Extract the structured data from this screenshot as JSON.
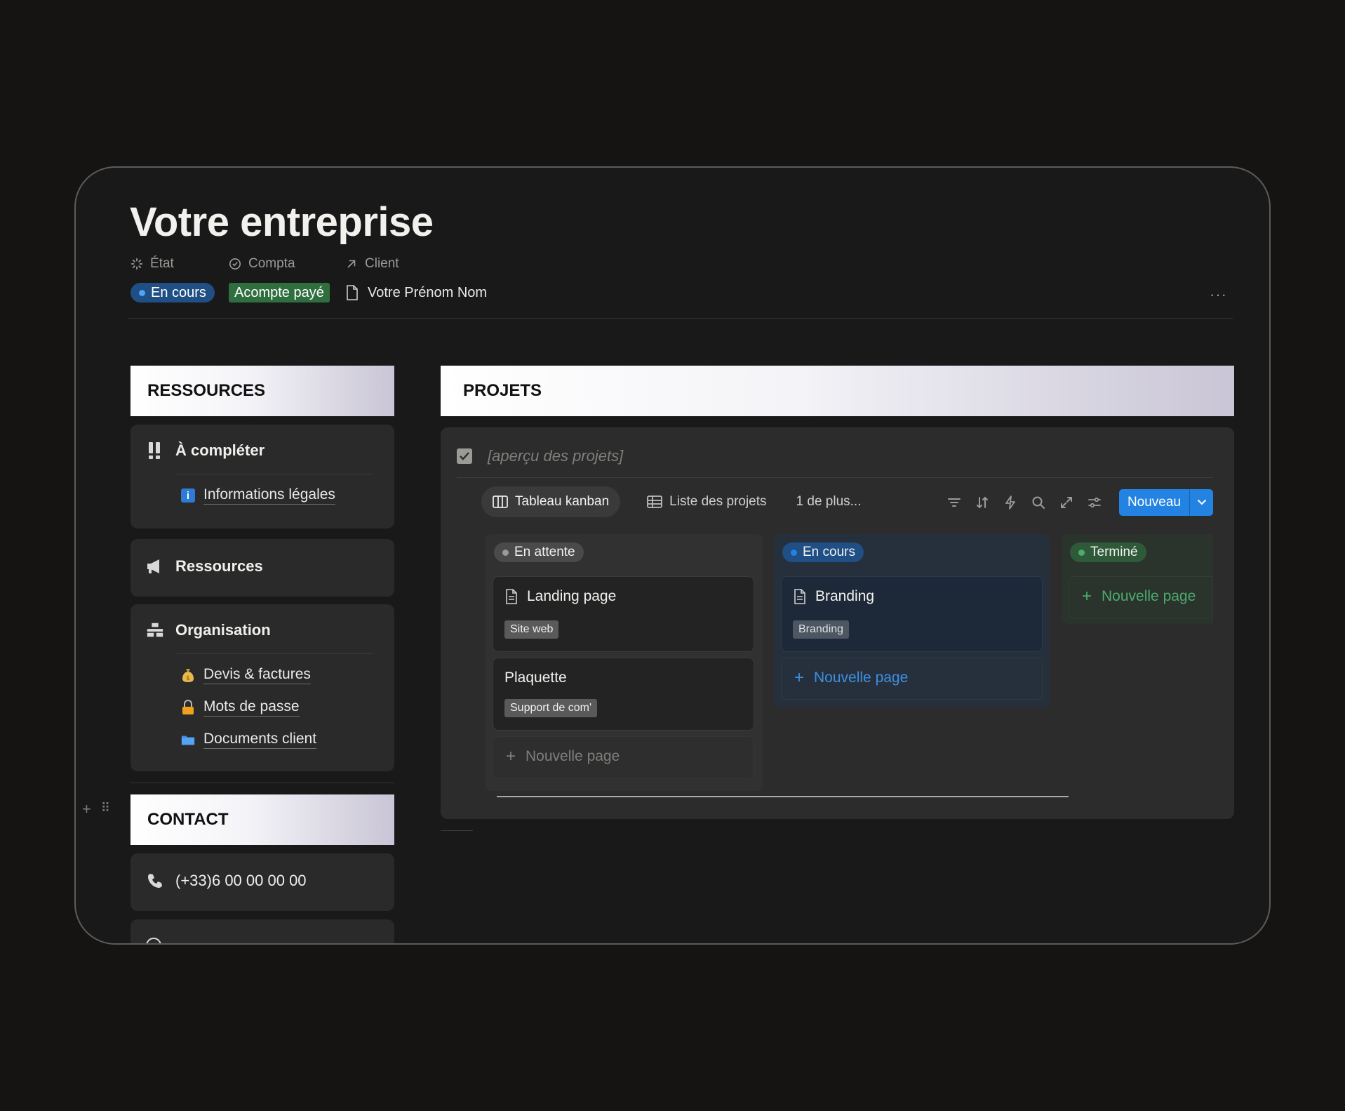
{
  "page": {
    "title": "Votre entreprise",
    "more_label": "···"
  },
  "properties": {
    "etat": {
      "label": "État",
      "value": "En cours",
      "icon": "status-spinner-icon"
    },
    "compta": {
      "label": "Compta",
      "value": "Acompte payé",
      "icon": "circle-check-icon"
    },
    "client": {
      "label": "Client",
      "value": "Votre Prénom Nom",
      "icon": "arrow-up-right-icon"
    }
  },
  "ressources": {
    "header": "RESSOURCES",
    "a_completer": {
      "label": "À compléter",
      "icon": "double-exclamation-icon",
      "items": [
        {
          "label": "Informations légales",
          "icon": "info-icon"
        }
      ]
    },
    "ressources_item": {
      "label": "Ressources",
      "icon": "megaphone-icon"
    },
    "organisation": {
      "label": "Organisation",
      "icon": "organisation-icon",
      "items": [
        {
          "label": "Devis & factures",
          "icon": "money-bag-icon"
        },
        {
          "label": "Mots de passe",
          "icon": "lock-icon"
        },
        {
          "label": "Documents client",
          "icon": "folder-icon"
        }
      ]
    }
  },
  "contact": {
    "header": "CONTACT",
    "phone": "(+33)6 00 00 00 00",
    "phone_icon": "phone-icon"
  },
  "projets": {
    "header": "PROJETS",
    "apercu": "[aperçu des projets]",
    "views": [
      {
        "label": "Tableau kanban",
        "icon": "board-icon",
        "active": true
      },
      {
        "label": "Liste des projets",
        "icon": "table-icon",
        "active": false
      },
      {
        "label": "1 de plus...",
        "icon": "",
        "active": false
      }
    ],
    "new_button": "Nouveau",
    "columns": [
      {
        "status": "En attente",
        "color": "#9b9a97",
        "cards": [
          {
            "title": "Landing page",
            "tag": "Site web"
          },
          {
            "title": "Plaquette",
            "tag": "Support de com'"
          }
        ],
        "new_page": "Nouvelle page"
      },
      {
        "status": "En cours",
        "color": "#2383e2",
        "cards": [
          {
            "title": "Branding",
            "tag": "Branding"
          }
        ],
        "new_page": "Nouvelle page"
      },
      {
        "status": "Terminé",
        "color": "#4dab6f",
        "cards": [],
        "new_page": "Nouvelle page"
      }
    ]
  },
  "colors": {
    "background": "#151413",
    "surface": "#191919",
    "card": "#2a2a2a",
    "accent_blue": "#2383e2",
    "accent_green": "#2f6e3f"
  }
}
